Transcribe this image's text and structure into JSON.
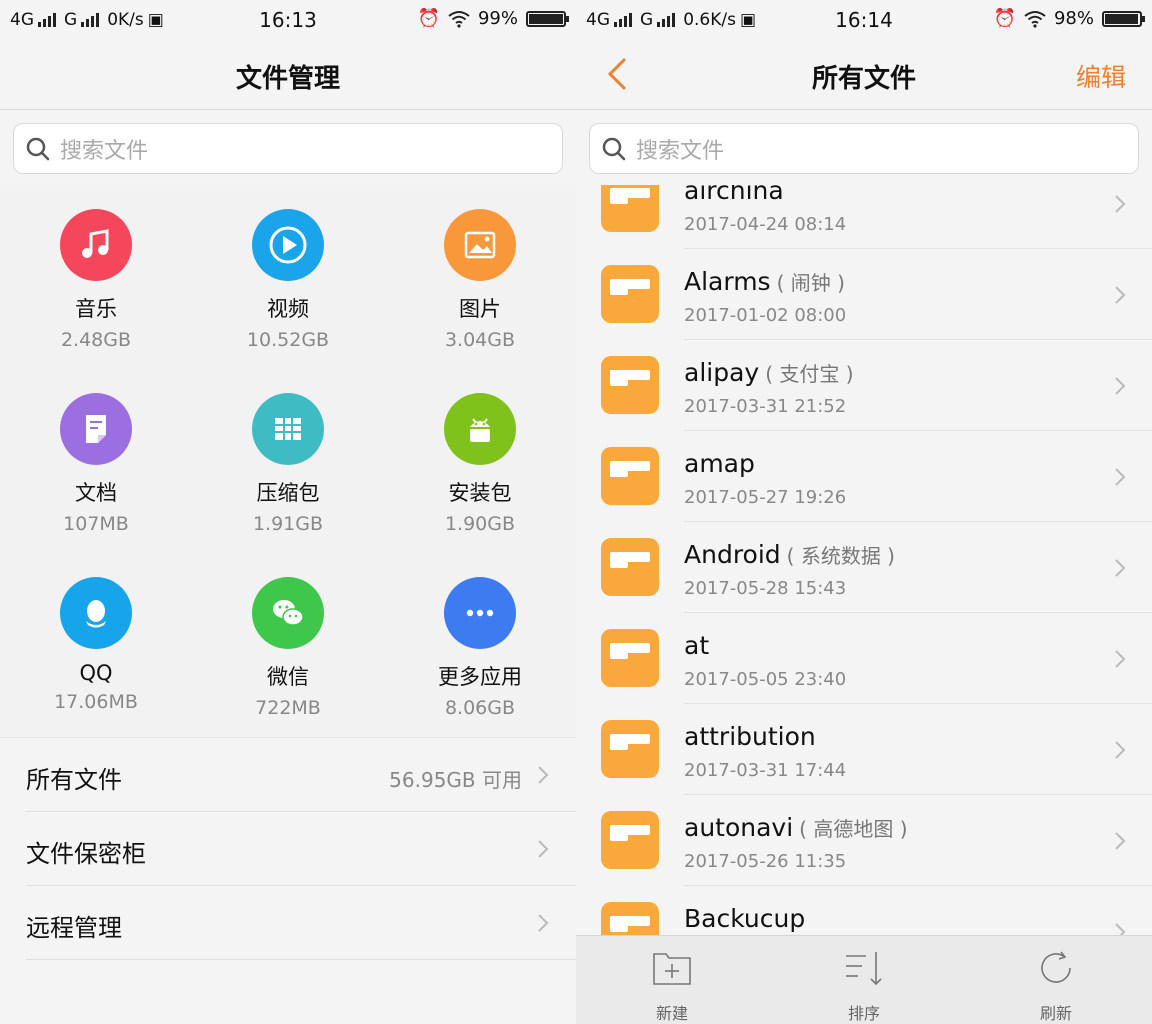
{
  "left": {
    "status": {
      "network1": "4G",
      "network2": "G",
      "speed": "0K/s",
      "time": "16:13",
      "battery": "99%",
      "battery_level": 0.99
    },
    "title": "文件管理",
    "search": {
      "placeholder": "搜索文件"
    },
    "categories": [
      {
        "name": "音乐",
        "size": "2.48GB",
        "color": "#f5475c",
        "icon": "music-icon"
      },
      {
        "name": "视频",
        "size": "10.52GB",
        "color": "#1aa5ea",
        "icon": "video-play-icon"
      },
      {
        "name": "图片",
        "size": "3.04GB",
        "color": "#f8983a",
        "icon": "image-icon"
      },
      {
        "name": "文档",
        "size": "107MB",
        "color": "#9b6fe0",
        "icon": "document-icon"
      },
      {
        "name": "压缩包",
        "size": "1.91GB",
        "color": "#3fbcc3",
        "icon": "archive-icon"
      },
      {
        "name": "安装包",
        "size": "1.90GB",
        "color": "#7fc21c",
        "icon": "android-icon"
      },
      {
        "name": "QQ",
        "size": "17.06MB",
        "color": "#16a4ea",
        "icon": "qq-penguin-icon"
      },
      {
        "name": "微信",
        "size": "722MB",
        "color": "#3ec74a",
        "icon": "wechat-icon"
      },
      {
        "name": "更多应用",
        "size": "8.06GB",
        "color": "#3d7cf0",
        "icon": "more-dots-icon"
      }
    ],
    "menu": [
      {
        "label": "所有文件",
        "value": "56.95GB 可用"
      },
      {
        "label": "文件保密柜",
        "value": ""
      },
      {
        "label": "远程管理",
        "value": ""
      }
    ]
  },
  "right": {
    "status": {
      "network1": "4G",
      "network2": "G",
      "speed": "0.6K/s",
      "time": "16:14",
      "battery": "98%",
      "battery_level": 0.98
    },
    "title": "所有文件",
    "edit_label": "编辑",
    "search": {
      "placeholder": "搜索文件"
    },
    "files": [
      {
        "name": "airchina",
        "alias": "",
        "date": "2017-04-24 08:14"
      },
      {
        "name": "Alarms",
        "alias": "( 闹钟 )",
        "date": "2017-01-02 08:00"
      },
      {
        "name": "alipay",
        "alias": "( 支付宝 )",
        "date": "2017-03-31 21:52"
      },
      {
        "name": "amap",
        "alias": "",
        "date": "2017-05-27 19:26"
      },
      {
        "name": "Android",
        "alias": "( 系统数据 )",
        "date": "2017-05-28 15:43"
      },
      {
        "name": "at",
        "alias": "",
        "date": "2017-05-05 23:40"
      },
      {
        "name": "attribution",
        "alias": "",
        "date": "2017-03-31 17:44"
      },
      {
        "name": "autonavi",
        "alias": "( 高德地图 )",
        "date": "2017-05-26 11:35"
      },
      {
        "name": "Backucup",
        "alias": "",
        "date": ""
      }
    ],
    "toolbar": [
      {
        "label": "新建",
        "icon": "new-folder-icon"
      },
      {
        "label": "排序",
        "icon": "sort-icon"
      },
      {
        "label": "刷新",
        "icon": "refresh-icon"
      }
    ],
    "accent": "#f07f2e"
  }
}
